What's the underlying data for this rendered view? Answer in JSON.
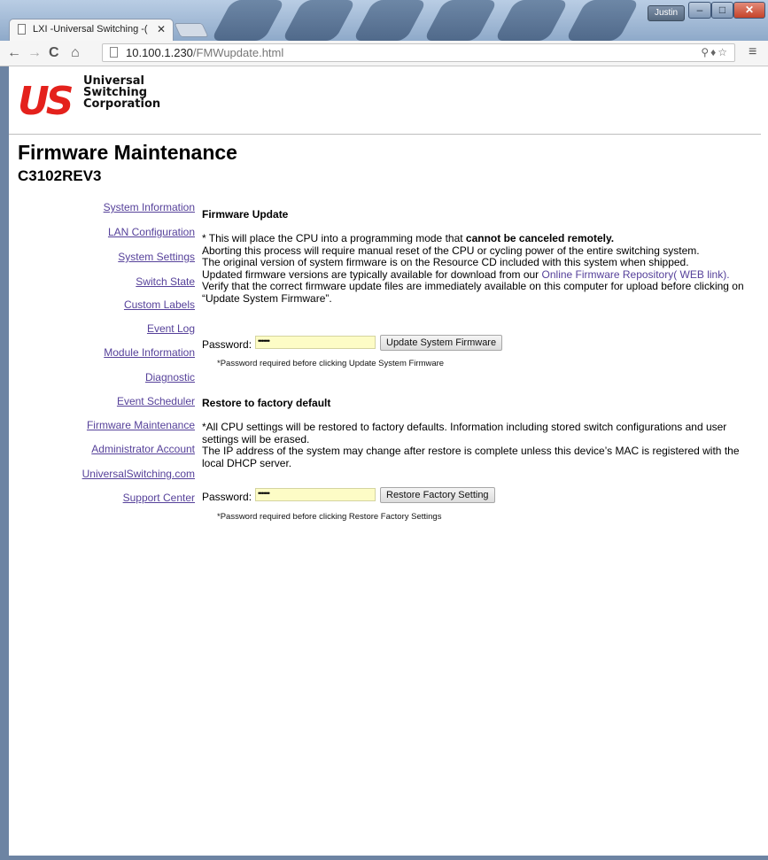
{
  "browser": {
    "tab_title": "LXI -Universal Switching -(",
    "tab_close": "✕",
    "user_badge": "Justin",
    "url_host": "10.100.1.230",
    "url_path": "/FMWupdate.html"
  },
  "logo": {
    "mark": "US",
    "line1": "Universal",
    "line2": "Switching",
    "line3": "Corporation"
  },
  "page": {
    "title": "Firmware Maintenance",
    "model": "C3102REV3"
  },
  "nav": {
    "items": [
      {
        "label": "System Information"
      },
      {
        "label": "LAN Configuration"
      },
      {
        "label": "System Settings"
      },
      {
        "label": "Switch State"
      },
      {
        "label": "Custom Labels"
      },
      {
        "label": "Event Log"
      },
      {
        "label": "Module Information"
      },
      {
        "label": "Diagnostic"
      },
      {
        "label": "Event Scheduler"
      },
      {
        "label": "Firmware Maintenance"
      },
      {
        "label": "Administrator Account"
      },
      {
        "label": "UniversalSwitching.com"
      },
      {
        "label": "Support Center"
      }
    ]
  },
  "firmware_update": {
    "heading": "Firmware Update",
    "line1_start": "* This will place the CPU into a programming mode that ",
    "line1_bold": "cannot be canceled remotely.",
    "line2": "Aborting this process will require manual reset of the CPU or cycling power of the entire switching system.",
    "line3": "The original version of system firmware is on the Resource CD included with this system when shipped.",
    "line4_start": "Updated firmware versions are typically available for download from our ",
    "line4_link": "Online Firmware Repository( WEB link).",
    "line5": "Verify that the correct firmware update files are immediately available on this computer for upload before clicking on “Update System Firmware”.",
    "password_label": "Password:",
    "password_value": "••••••",
    "button_label": "Update System Firmware",
    "note": "*Password required before clicking Update System Firmware"
  },
  "factory_reset": {
    "heading": "Restore to factory default",
    "line1": "*All CPU settings will be restored to factory defaults. Information including stored switch configurations and user settings will be erased.",
    "line2": "The IP address of the system may change after restore is complete unless this device’s MAC is registered with the local DHCP server.",
    "password_label": "Password:",
    "password_value": "••••••",
    "button_label": "Restore Factory Setting",
    "note": "*Password required before clicking Restore Factory Settings"
  }
}
